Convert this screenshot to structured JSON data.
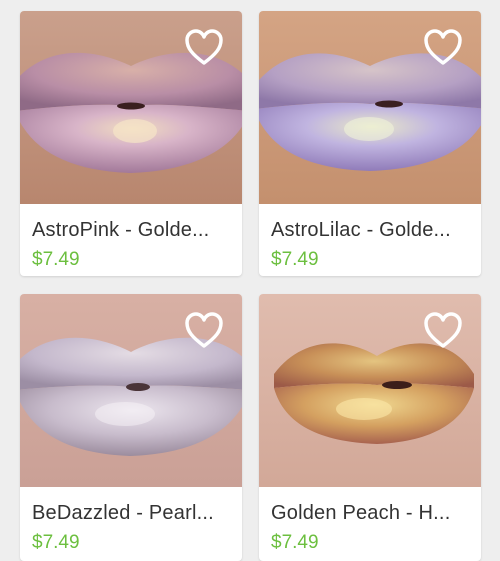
{
  "accent_price_color": "#6cbf3f",
  "products": [
    {
      "title": "AstroPink - Golden Pink Metallic Lipstick",
      "display_title": "AstroPink - Golde...",
      "price": "$7.49",
      "favorite_icon": "heart-outline-icon"
    },
    {
      "title": "AstroLilac - Golden Lilac Metallic Lipstick",
      "display_title": "AstroLilac - Golde...",
      "price": "$7.49",
      "favorite_icon": "heart-outline-icon"
    },
    {
      "title": "BeDazzled - Pearl Lipstick",
      "display_title": "BeDazzled - Pearl...",
      "price": "$7.49",
      "favorite_icon": "heart-outline-icon"
    },
    {
      "title": "Golden Peach - Holographic Lipstick",
      "display_title": "Golden Peach - H...",
      "price": "$7.49",
      "favorite_icon": "heart-outline-icon"
    }
  ]
}
